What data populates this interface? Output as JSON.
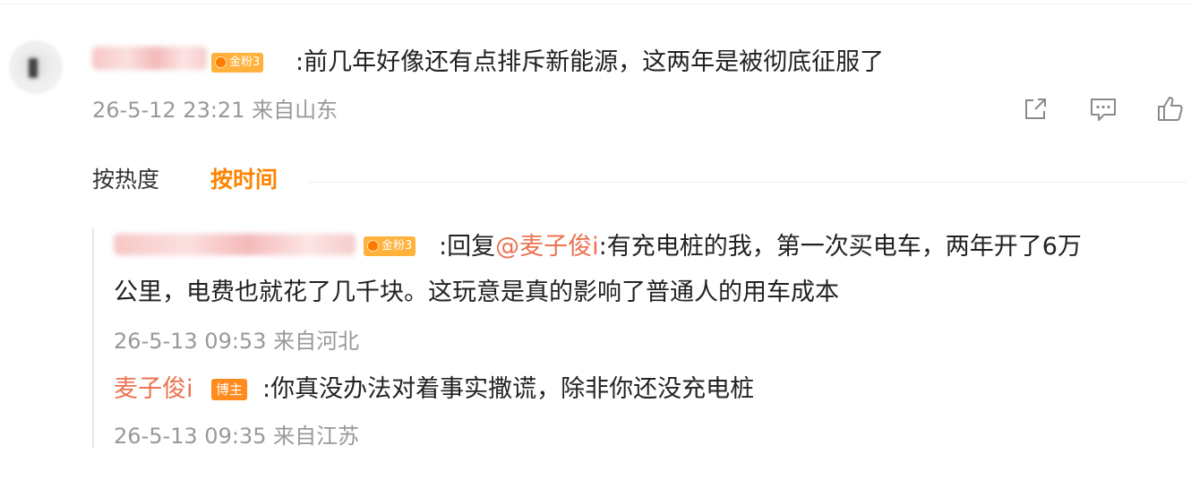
{
  "comment": {
    "badge": "金粉3",
    "text": ":前几年好像还有点排斥新能源，这两年是被彻底征服了",
    "meta": "26-5-12 23:21 来自山东",
    "actions": [
      {
        "name": "share-icon"
      },
      {
        "name": "comment-icon"
      },
      {
        "name": "like-icon"
      }
    ]
  },
  "sort": {
    "hot": "按热度",
    "time": "按时间"
  },
  "replies": [
    {
      "badge": "金粉3",
      "prefix": ":回复",
      "mention": "@麦子俊i",
      "text_line1": ":有充电桩的我，第一次买电车，两年开了6万",
      "text_line2": "公里，电费也就花了几千块。这玩意是真的影响了普通人的用车成本",
      "meta": "26-5-13 09:53 来自河北"
    },
    {
      "author": "麦子俊i",
      "badge": "博主",
      "text": ":你真没办法对着事实撒谎，除非你还没充电桩",
      "meta": "26-5-13 09:35 来自江苏"
    }
  ],
  "colors": {
    "accent_orange": "#ff8200",
    "link": "#eb7350",
    "meta_gray": "#999999",
    "badge_gold": "#ffb13b"
  }
}
